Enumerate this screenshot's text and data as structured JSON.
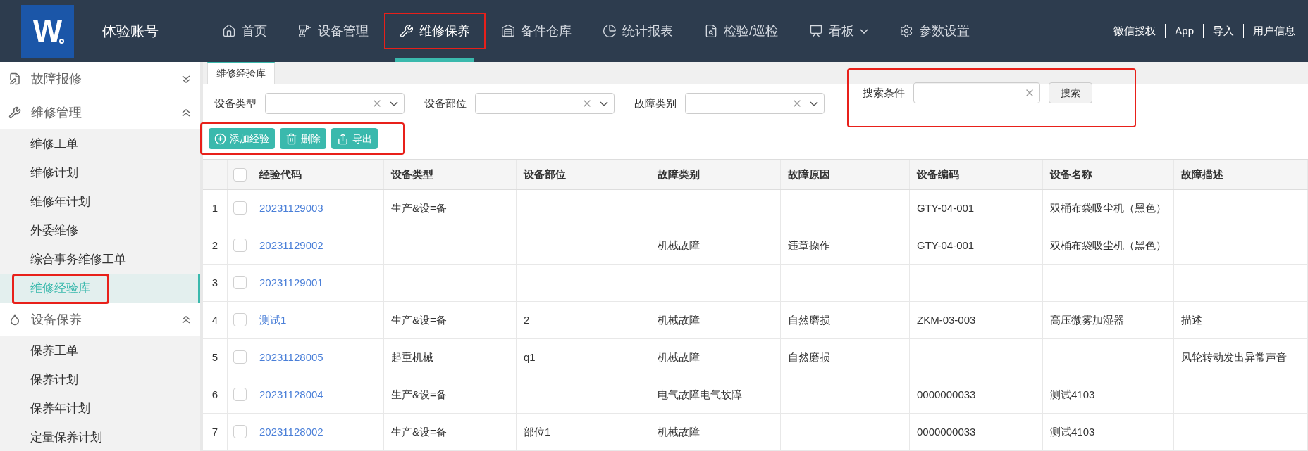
{
  "header": {
    "logo": "W",
    "account": "体验账号",
    "nav": [
      {
        "label": "首页",
        "selected": false,
        "highlighted": false,
        "dropdown": false
      },
      {
        "label": "设备管理",
        "selected": false,
        "highlighted": false,
        "dropdown": false
      },
      {
        "label": "维修保养",
        "selected": true,
        "highlighted": true,
        "dropdown": false
      },
      {
        "label": "备件仓库",
        "selected": false,
        "highlighted": false,
        "dropdown": false
      },
      {
        "label": "统计报表",
        "selected": false,
        "highlighted": false,
        "dropdown": false
      },
      {
        "label": "检验/巡检",
        "selected": false,
        "highlighted": false,
        "dropdown": false
      },
      {
        "label": "看板",
        "selected": false,
        "highlighted": false,
        "dropdown": true
      },
      {
        "label": "参数设置",
        "selected": false,
        "highlighted": false,
        "dropdown": false
      }
    ],
    "links": [
      "微信授权",
      "App",
      "导入",
      "用户信息"
    ]
  },
  "sidebar": {
    "groups": [
      {
        "label": "故障报修",
        "expanded": false
      },
      {
        "label": "维修管理",
        "expanded": true,
        "items": [
          {
            "label": "维修工单",
            "selected": false,
            "highlighted": false
          },
          {
            "label": "维修计划",
            "selected": false,
            "highlighted": false
          },
          {
            "label": "维修年计划",
            "selected": false,
            "highlighted": false
          },
          {
            "label": "外委维修",
            "selected": false,
            "highlighted": false
          },
          {
            "label": "综合事务维修工单",
            "selected": false,
            "highlighted": false
          },
          {
            "label": "维修经验库",
            "selected": true,
            "highlighted": true
          }
        ]
      },
      {
        "label": "设备保养",
        "expanded": true,
        "items": [
          {
            "label": "保养工单",
            "selected": false,
            "highlighted": false
          },
          {
            "label": "保养计划",
            "selected": false,
            "highlighted": false
          },
          {
            "label": "保养年计划",
            "selected": false,
            "highlighted": false
          },
          {
            "label": "定量保养计划",
            "selected": false,
            "highlighted": false
          }
        ]
      }
    ]
  },
  "tabs": [
    {
      "label": "维修经验库",
      "selected": true
    }
  ],
  "filters": [
    {
      "label": "设备类型",
      "kind": "select"
    },
    {
      "label": "设备部位",
      "kind": "select"
    },
    {
      "label": "故障类别",
      "kind": "select"
    }
  ],
  "search": {
    "label": "搜索条件",
    "button": "搜索",
    "highlighted": true
  },
  "toolbar": {
    "highlighted": true,
    "buttons": [
      "添加经验",
      "删除",
      "导出"
    ]
  },
  "table": {
    "all_checked": false,
    "columns": [
      "经验代码",
      "设备类型",
      "设备部位",
      "故障类别",
      "故障原因",
      "设备编码",
      "设备名称",
      "故障描述"
    ],
    "rows": [
      {
        "index": "1",
        "checked": false,
        "cells": [
          "20231129003",
          "生产&设=备",
          "",
          "",
          "",
          "GTY-04-001",
          "双桶布袋吸尘机（黑色）",
          ""
        ]
      },
      {
        "index": "2",
        "checked": false,
        "cells": [
          "20231129002",
          "",
          "",
          "机械故障",
          "违章操作",
          "GTY-04-001",
          "双桶布袋吸尘机（黑色）",
          ""
        ]
      },
      {
        "index": "3",
        "checked": false,
        "cells": [
          "20231129001",
          "",
          "",
          "",
          "",
          "",
          "",
          ""
        ]
      },
      {
        "index": "4",
        "checked": false,
        "cells": [
          "测试1",
          "生产&设=备",
          "2",
          "机械故障",
          "自然磨损",
          "ZKM-03-003",
          "高压微雾加湿器",
          "描述"
        ]
      },
      {
        "index": "5",
        "checked": false,
        "cells": [
          "20231128005",
          "起重机械",
          "q1",
          "机械故障",
          "自然磨损",
          "",
          "",
          "风轮转动发出异常声音"
        ]
      },
      {
        "index": "6",
        "checked": false,
        "cells": [
          "20231128004",
          "生产&设=备",
          "",
          "电气故障电气故障",
          "",
          "0000000033",
          "测试4103",
          ""
        ]
      },
      {
        "index": "7",
        "checked": false,
        "cells": [
          "20231128002",
          "生产&设=备",
          "部位1",
          "机械故障",
          "",
          "0000000033",
          "测试4103",
          ""
        ]
      }
    ]
  }
}
